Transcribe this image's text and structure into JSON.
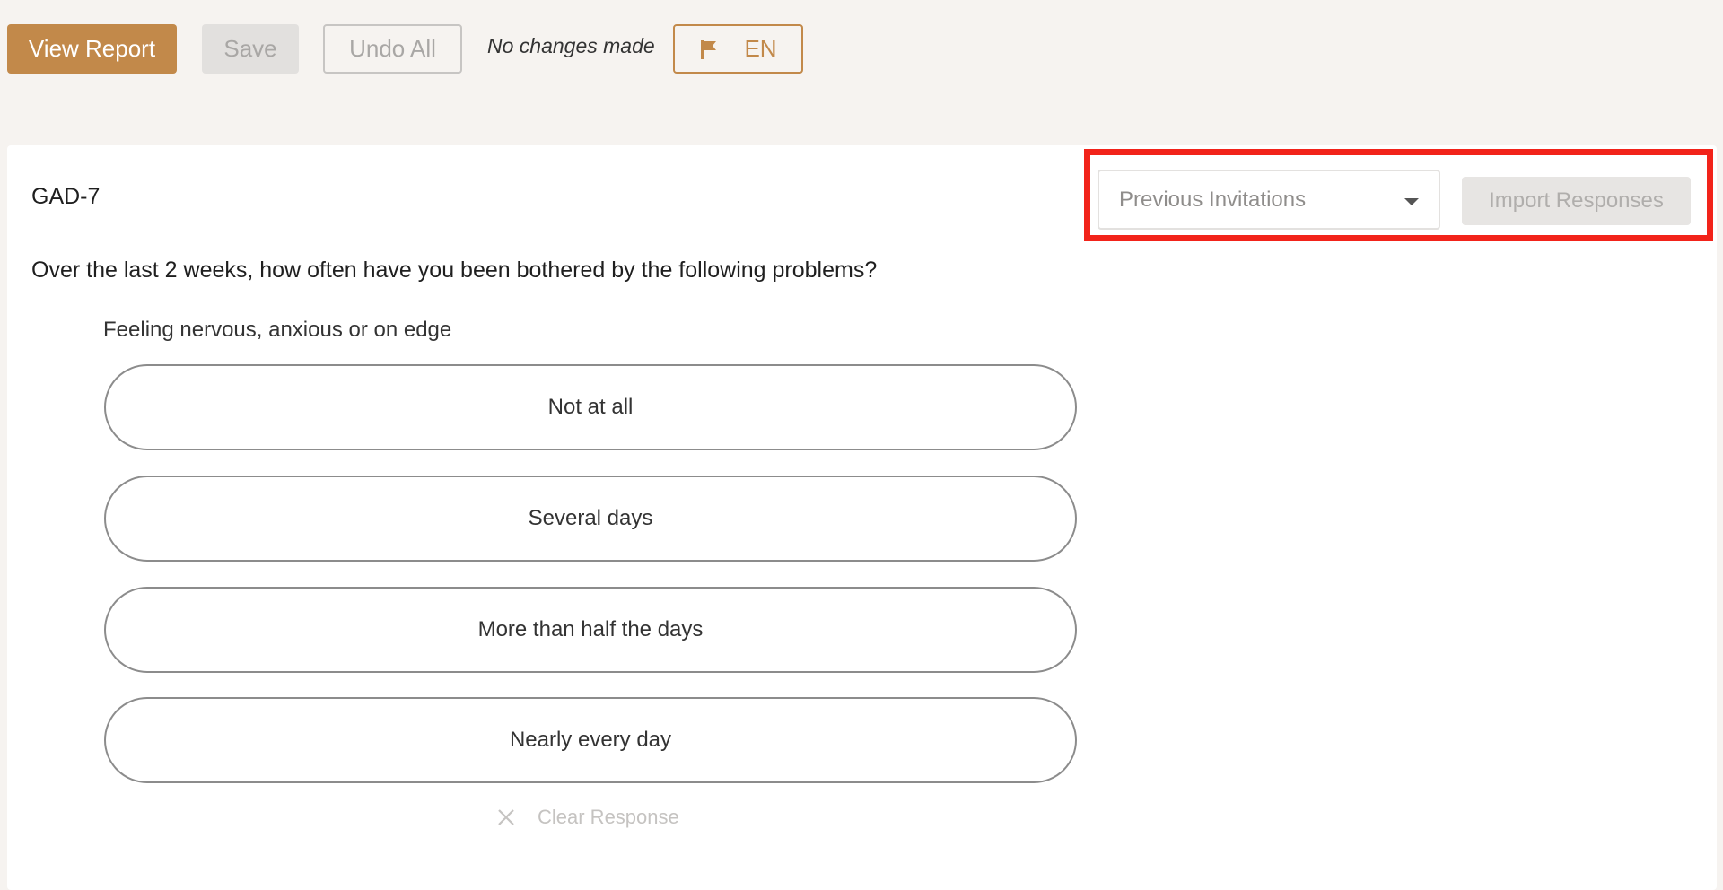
{
  "toolbar": {
    "view_report_label": "View Report",
    "save_label": "Save",
    "undo_all_label": "Undo All",
    "status": "No changes made",
    "language_label": "EN",
    "language_icon": "flag-icon"
  },
  "form": {
    "title": "GAD-7",
    "previous_invitations": {
      "label": "Previous Invitations",
      "icon": "caret-down-icon"
    },
    "import_responses_label": "Import Responses",
    "question": "Over the last 2 weeks, how often have you been bothered by the following problems?",
    "item": {
      "label": "Feeling nervous, anxious or on edge",
      "options": [
        "Not at all",
        "Several days",
        "More than half the days",
        "Nearly every day"
      ],
      "clear_label": "Clear Response",
      "clear_icon": "close-icon"
    }
  },
  "colors": {
    "accent": "#c2894a",
    "highlight": "#f2231a",
    "background": "#f6f3f0"
  }
}
